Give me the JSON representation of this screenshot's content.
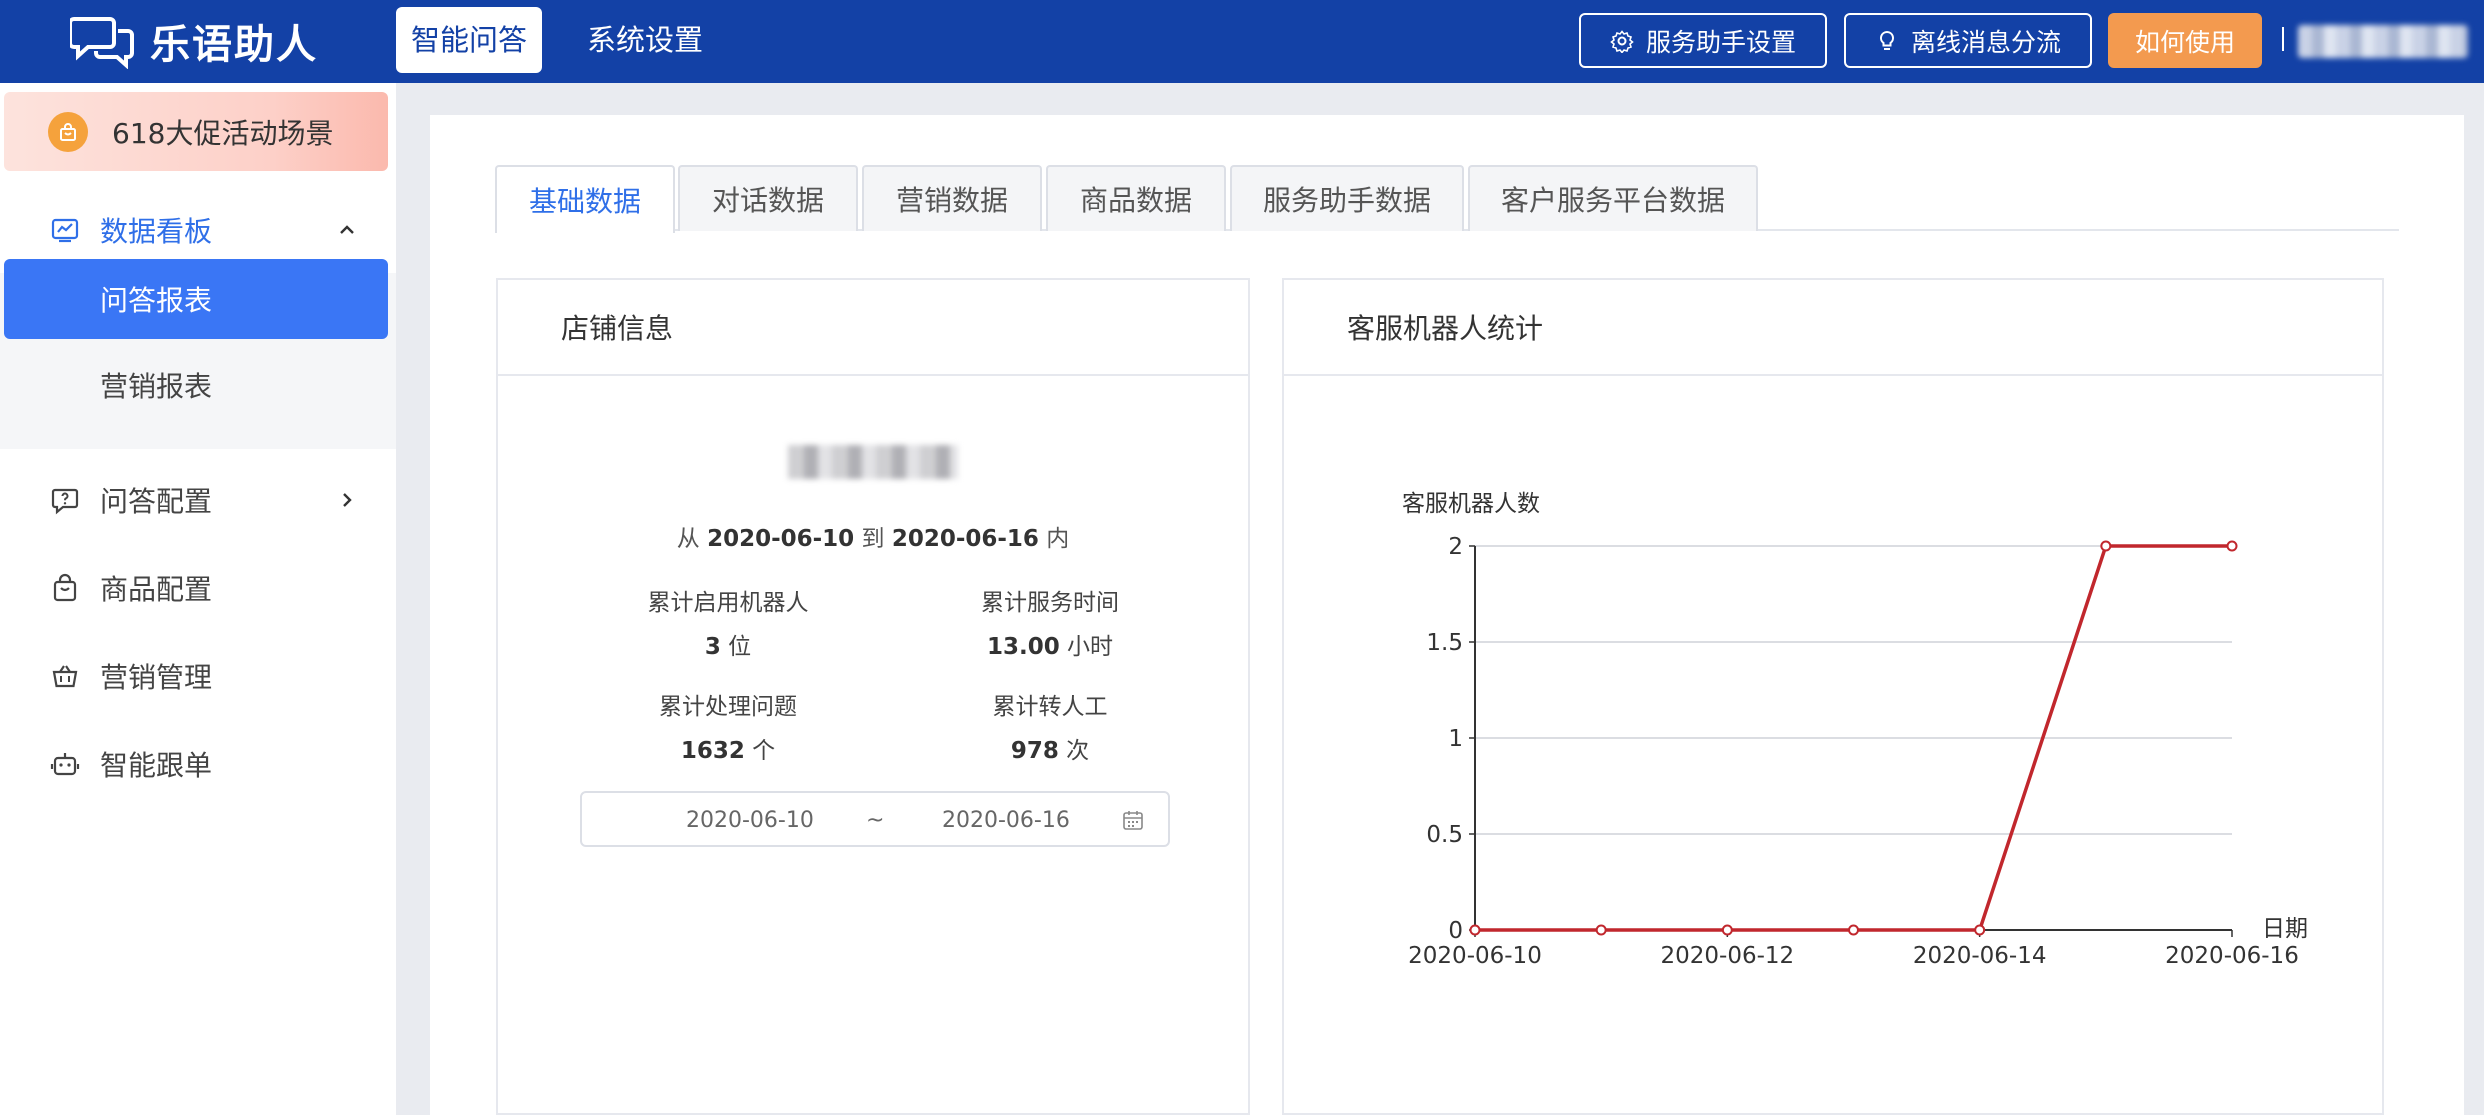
{
  "app": {
    "name": "乐语助人",
    "nav": [
      {
        "label": "智能问答",
        "active": true
      },
      {
        "label": "系统设置",
        "active": false
      }
    ],
    "actions": {
      "assistant_settings": "服务助手设置",
      "offline_routing": "离线消息分流",
      "how_to_use": "如何使用"
    },
    "accent": "#1341a6",
    "orange": "#f39a4f"
  },
  "sidebar": {
    "scene": "618大促活动场景",
    "dashboard": "数据看板",
    "sub_items": [
      "问答报表",
      "营销报表"
    ],
    "items": [
      "问答配置",
      "商品配置",
      "营销管理",
      "智能跟单"
    ]
  },
  "tabs": [
    "基础数据",
    "对话数据",
    "营销数据",
    "商品数据",
    "服务助手数据",
    "客户服务平台数据"
  ],
  "shop": {
    "title": "店铺信息",
    "range_prefix": "从",
    "range_start": "2020-06-10",
    "range_mid": "到",
    "range_end": "2020-06-16",
    "range_suffix": "内",
    "stats": [
      {
        "label": "累计启用机器人",
        "value": "3",
        "unit": "位"
      },
      {
        "label": "累计服务时间",
        "value": "13.00",
        "unit": "小时"
      },
      {
        "label": "累计处理问题",
        "value": "1632",
        "unit": "个"
      },
      {
        "label": "累计转人工",
        "value": "978",
        "unit": "次"
      }
    ],
    "date_start": "2020-06-10",
    "date_sep": "~",
    "date_end": "2020-06-16"
  },
  "robot_panel": {
    "title": "客服机器人统计"
  },
  "chart_data": {
    "type": "line",
    "ylabel": "客服机器人数",
    "xlabel": "日期",
    "x": [
      "2020-06-10",
      "2020-06-11",
      "2020-06-12",
      "2020-06-13",
      "2020-06-14",
      "2020-06-15",
      "2020-06-16"
    ],
    "xtick_labels": [
      "2020-06-10",
      "2020-06-12",
      "2020-06-14",
      "2020-06-16"
    ],
    "yticks": [
      "0",
      "0.5",
      "1",
      "1.5",
      "2"
    ],
    "ylim": [
      0,
      2
    ],
    "series": [
      {
        "values": [
          0,
          0,
          0,
          0,
          0,
          2,
          2
        ],
        "color": "#c1272d"
      }
    ],
    "grid": true
  }
}
